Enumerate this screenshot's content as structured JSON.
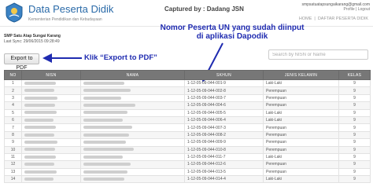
{
  "header": {
    "app_title": "Data Peserta Didik",
    "app_subtitle": "Kementerian Pendidikan dan Kebudayaan",
    "captured_by": "Captured by : Dadang JSN",
    "user_email": "smpsatuatapsungaikarang@gmail.com",
    "user_menu": "Profile | Logout",
    "breadcrumb": [
      "HOME",
      "DAFTAR PESERTA DIDIK"
    ]
  },
  "school": {
    "name": "SMP Satu Atap Sungai Karang",
    "last_sync": "Last Sync: 29/06/2015 09:28:49"
  },
  "toolbar": {
    "export_label": "Export to PDF",
    "search_placeholder": "Search by NISN or Name"
  },
  "annotations": {
    "un_line1": "Nomor Peserta UN yang sudah diinput",
    "un_line2": "di aplikasi Dapodik",
    "export_note": "Klik “Export to PDF”"
  },
  "table": {
    "columns": [
      "NO",
      "NISN",
      "NAMA",
      "SKHUN",
      "JENIS KELAMIN",
      "KELAS"
    ],
    "rows": [
      {
        "no": "1",
        "skhun": "1-12-05-09-044-001-9",
        "gender": "Laki-Laki",
        "kelas": "9"
      },
      {
        "no": "2",
        "skhun": "1-12-05-09-044-002-8",
        "gender": "Perempuan",
        "kelas": "9"
      },
      {
        "no": "3",
        "skhun": "1-12-05-09-044-003-7",
        "gender": "Perempuan",
        "kelas": "9"
      },
      {
        "no": "4",
        "skhun": "1-12-05-09-044-004-6",
        "gender": "Perempuan",
        "kelas": "9"
      },
      {
        "no": "5",
        "skhun": "1-12-05-09-044-005-5",
        "gender": "Laki-Laki",
        "kelas": "9"
      },
      {
        "no": "6",
        "skhun": "1-12-05-09-044-006-4",
        "gender": "Laki-Laki",
        "kelas": "9"
      },
      {
        "no": "7",
        "skhun": "1-12-05-09-044-007-3",
        "gender": "Perempuan",
        "kelas": "9"
      },
      {
        "no": "8",
        "skhun": "1-12-05-09-044-008-2",
        "gender": "Perempuan",
        "kelas": "9"
      },
      {
        "no": "9",
        "skhun": "1-12-05-09-044-009-9",
        "gender": "Perempuan",
        "kelas": "9"
      },
      {
        "no": "10",
        "skhun": "1-12-05-09-044-010-8",
        "gender": "Perempuan",
        "kelas": "9"
      },
      {
        "no": "11",
        "skhun": "1-12-05-09-044-011-7",
        "gender": "Laki-Laki",
        "kelas": "9"
      },
      {
        "no": "12",
        "skhun": "1-12-05-09-044-012-6",
        "gender": "Perempuan",
        "kelas": "9"
      },
      {
        "no": "13",
        "skhun": "1-12-05-09-044-013-5",
        "gender": "Perempuan",
        "kelas": "9"
      },
      {
        "no": "14",
        "skhun": "1-12-05-09-044-014-4",
        "gender": "Laki-Laki",
        "kelas": "9"
      }
    ]
  },
  "colors": {
    "annotation": "#1f2bb0",
    "table_header": "#777777",
    "title": "#2a6aa8"
  },
  "icons": {
    "logo": "tut-wuri-handayani-logo-icon"
  }
}
